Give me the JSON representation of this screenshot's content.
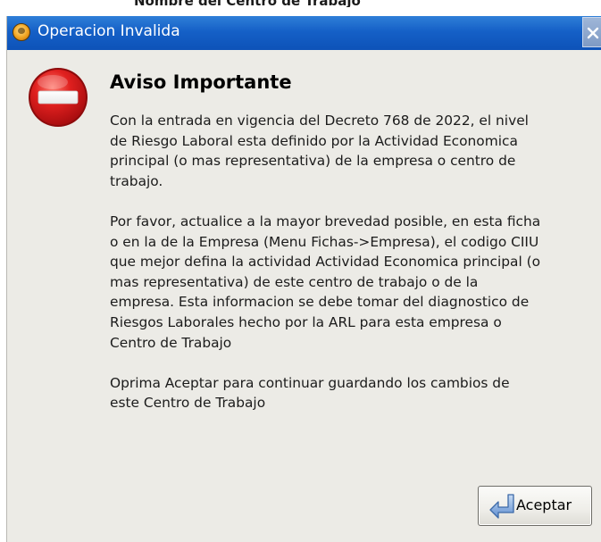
{
  "backdrop": {
    "partial_text": "Nombre del Centro de Trabajo"
  },
  "window": {
    "title": "Operacion Invalida",
    "title_icon": "warning-icon",
    "close_icon": "close-icon"
  },
  "dialog": {
    "icon": "stop-icon",
    "heading": "Aviso Importante",
    "paragraphs": [
      [
        "Con la entrada en vigencia del Decreto 768 de 2022, el nivel",
        "de Riesgo Laboral esta definido por la Actividad Economica",
        "principal (o mas representativa) de la empresa o centro de",
        "trabajo."
      ],
      [
        "Por favor, actualice a la mayor brevedad posible, en esta ficha",
        "o en la de la Empresa (Menu Fichas->Empresa), el codigo CIIU",
        "que mejor defina la actividad Actividad Economica principal (o",
        "mas representativa) de este centro de trabajo o de la",
        "empresa. Esta informacion se debe tomar del diagnostico de",
        "Riesgos Laborales hecho por la ARL para esta empresa o",
        "Centro de Trabajo"
      ],
      [
        "Oprima Aceptar para continuar guardando los cambios de",
        "este Centro de Trabajo"
      ]
    ],
    "accept_button": {
      "label": "Aceptar",
      "icon": "return-arrow-icon"
    }
  },
  "colors": {
    "titlebar": "#1560c7",
    "dialog_bg": "#ecebe6",
    "stop_red": "#d9161b"
  }
}
